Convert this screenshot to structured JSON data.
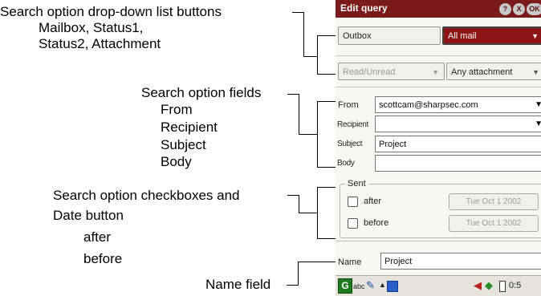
{
  "annotations": {
    "dropdown": [
      "Search option drop-down list buttons",
      "Mailbox, Status1,",
      "Status2, Attachment"
    ],
    "fields": [
      "Search option fields",
      "From",
      "Recipient",
      "Subject",
      "Body"
    ],
    "checkboxes": [
      "Search option checkboxes and",
      "Date button",
      "after",
      "before"
    ],
    "name_field": "Name field"
  },
  "window": {
    "title": "Edit query",
    "title_icons": [
      "?",
      "X",
      "OK"
    ]
  },
  "mailbox": {
    "value": "Outbox"
  },
  "status1": {
    "value": "All mail"
  },
  "status2": {
    "value": "Read/Unread"
  },
  "attachment": {
    "value": "Any attachment"
  },
  "from": {
    "label": "From",
    "value": "scottcam@sharpsec.com"
  },
  "recipient": {
    "label": "Recipient",
    "value": ""
  },
  "subject": {
    "label": "Subject",
    "value": "Project"
  },
  "body": {
    "label": "Body",
    "value": ""
  },
  "sent": {
    "legend": "Sent",
    "after": {
      "label": "after",
      "date": "Tue Oct 1 2002"
    },
    "before": {
      "label": "before",
      "date": "Tue Oct 1 2002"
    }
  },
  "name": {
    "label": "Name",
    "value": "Project"
  },
  "taskbar": {
    "start": "G",
    "ime": "abc",
    "clock": "0:5"
  }
}
